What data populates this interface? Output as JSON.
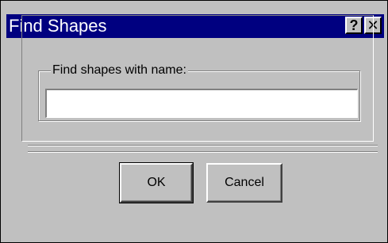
{
  "window": {
    "title": "Find Shapes",
    "help_label": "?",
    "close_label": "✕"
  },
  "form": {
    "group_label": "Find shapes with name:",
    "name_value": "",
    "name_placeholder": ""
  },
  "buttons": {
    "ok_label": "OK",
    "cancel_label": "Cancel"
  },
  "colors": {
    "titlebar": "#000080",
    "face": "#c0c0c0"
  }
}
